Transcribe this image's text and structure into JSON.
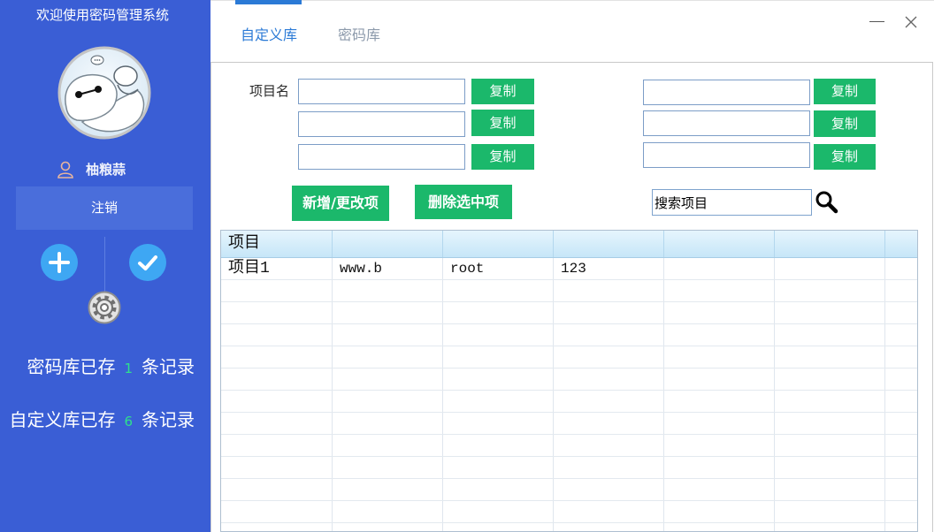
{
  "sidebar": {
    "title": "欢迎使用密码管理系统",
    "username": "柚粮蒜",
    "logout_label": "注销",
    "stats": [
      {
        "prefix": "密码库已存",
        "count": "1",
        "suffix": "条记录"
      },
      {
        "prefix": "自定义库已存",
        "count": "6",
        "suffix": "条记录"
      }
    ],
    "icons": {
      "avatar": "baymax-avatar",
      "user": "user-icon",
      "add": "plus-icon",
      "confirm": "check-icon",
      "settings": "gear-icon"
    }
  },
  "tabs": [
    {
      "label": "自定义库",
      "active": true
    },
    {
      "label": "密码库",
      "active": false
    }
  ],
  "window_controls": {
    "minimize": "minimize-icon",
    "close": "close-icon"
  },
  "form": {
    "item_name_label": "项目名",
    "left_fields": [
      "",
      "",
      ""
    ],
    "right_fields": [
      "",
      "",
      ""
    ],
    "copy_label": "复制",
    "add_update_label": "新增/更改项",
    "delete_selected_label": "删除选中项",
    "search_value": "搜索项目",
    "search_icon": "search-icon"
  },
  "table": {
    "columns": [
      "项目",
      "",
      "",
      "",
      "",
      "",
      ""
    ],
    "rows": [
      [
        "项目1",
        "www.b",
        "root",
        "123",
        "",
        "",
        ""
      ]
    ]
  },
  "colors": {
    "sidebar_bg": "#3a5ed5",
    "sidebar_panel": "#4a6edb",
    "icon_circle": "#3ea7f3",
    "action_green": "#1bb86b",
    "count_green": "#2fe08c",
    "tab_active": "#2b7ad6",
    "tab_inactive": "#8c9aab"
  }
}
